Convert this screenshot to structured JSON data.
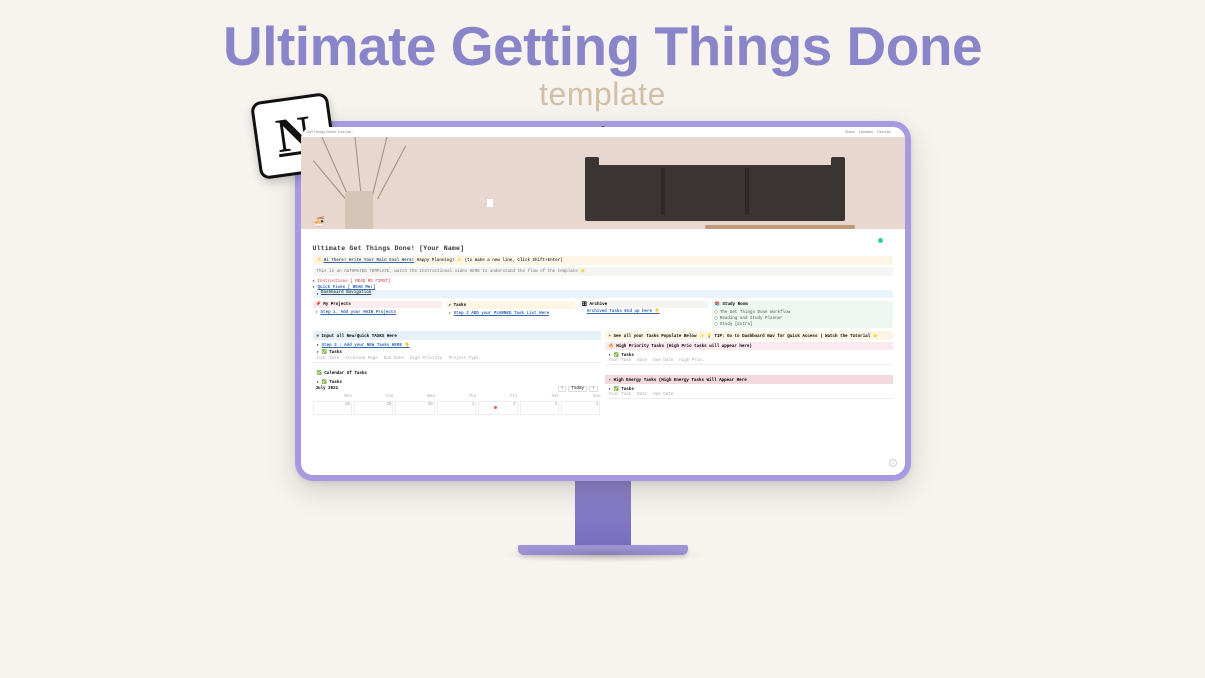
{
  "hero": {
    "title": "Ultimate Getting Things Done",
    "subtitle": "template"
  },
  "topbar": {
    "breadcrumb": "Get Things Done! Your Na…",
    "share": "Share",
    "updates": "Updates",
    "favorite": "Favorite",
    "more": "…"
  },
  "page": {
    "icon": "🍜",
    "title": "Ultimate Get Things Done! [Your Name]",
    "callout_main": "Hi There! Write Your Main Goal Here!",
    "callout_tail": "Happy Planning! ✨  (to make a new line, click Shift+Enter)",
    "callout_sub": "This is an AUTOMATED TEMPLATE, watch the Instructional video HERE to understand the flow of the template ⭐",
    "toggles": {
      "instructions": "Instructions [ READ ME FIRST]",
      "quick": "Quick Fixes [ READ Me!]",
      "dash": "Dashboard Navigation"
    }
  },
  "quad": {
    "projects": {
      "hd": "📌 My Projects",
      "line": "Step 1. Add your MAIN Projects"
    },
    "tasks": {
      "hd": "✔ Tasks",
      "line": "Step 2 ADD your PLANNED Task List Here"
    },
    "archive": {
      "hd": "🗄 Archive",
      "line": "Archived Tasks End up here 👇"
    },
    "study": {
      "hd": "📚 Study Room",
      "a": "The Get Things Done Workflow",
      "b": "Reading and Study Planner",
      "c": "Study [Extra]"
    }
  },
  "left": {
    "input_hd": "❄ Input all New/Quick TASKS Here",
    "step3": "Step 3 : Add your NEW Tasks HERE 👇",
    "db": "✅ Tasks",
    "cols": {
      "a": "Your Task",
      "b": "Archived Page",
      "c": "Due Date",
      "d": "High Priority",
      "e": "Project Type"
    },
    "cal_hd": "✅ Calendar Of Tasks",
    "month": "July 2021",
    "today": "Today",
    "wk": [
      "Mon",
      "Tue",
      "Wed",
      "Thu",
      "Fri",
      "Sat",
      "Sun"
    ],
    "days": [
      "28",
      "29",
      "30",
      "1",
      "2",
      "3",
      "4"
    ]
  },
  "right": {
    "tip_hd": "☀ See all your Tasks Populate Below ✨ 💡 TIP: Go to Dashboard Nav for Quick Access | Watch the Tutorial ⭐",
    "prio_hd": "🔥 High Priority Tasks (High Prio tasks will appear here)",
    "db": "✅ Tasks",
    "cols": {
      "a": "Your Task",
      "b": "Date",
      "c": "Due Date",
      "d": "High Prio…"
    },
    "energy_hd": "⚡ High Energy Tasks (High Energy Tasks Will Appear Here",
    "ecols": {
      "a": "Your Task",
      "b": "Date",
      "c": "Due Date"
    }
  }
}
